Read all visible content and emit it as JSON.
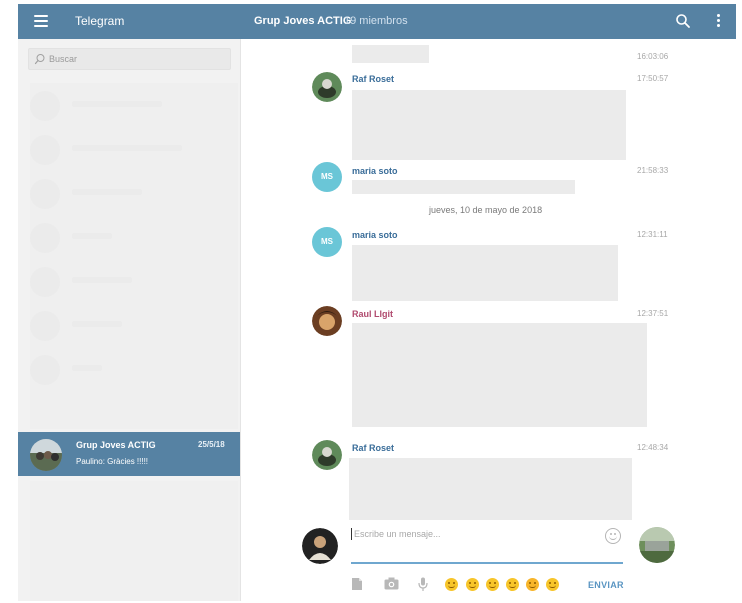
{
  "header": {
    "app_title": "Telegram",
    "chat_title": "Grup Joves ACTIG",
    "chat_members": "19 miembros",
    "accent_color": "#5682a3"
  },
  "sidebar": {
    "search_placeholder": "Buscar",
    "active_chat": {
      "name": "Grup Joves ACTIG",
      "date": "25/5/18",
      "preview": "Paulino: Gràcies !!!!!"
    }
  },
  "messages": {
    "first_time": "16:03:06",
    "items": [
      {
        "sender": "Raf Roset",
        "time": "17:50:57",
        "sender_color": "#3a6d99"
      },
      {
        "sender": "maria soto",
        "time": "21:58:33",
        "initials": "MS",
        "sender_color": "#3a6d99"
      },
      {
        "sender": "maria soto",
        "time": "12:31:11",
        "initials": "MS",
        "sender_color": "#3a6d99"
      },
      {
        "sender": "Raul Llgit",
        "time": "12:37:51",
        "sender_color": "#b04a6e"
      },
      {
        "sender": "Raf Roset",
        "time": "12:48:34",
        "sender_color": "#3a6d99"
      }
    ],
    "date_separator": "jueves, 10 de mayo de 2018"
  },
  "composer": {
    "placeholder": "Escribe un mensaje...",
    "send_label": "ENVIAR",
    "tools": [
      "document-icon",
      "camera-icon",
      "microphone-icon"
    ],
    "emoji_shortcuts": [
      "smile-emoji",
      "grin-emoji",
      "blush-emoji",
      "sad-emoji",
      "heart-eyes-emoji",
      "grimace-emoji"
    ]
  }
}
